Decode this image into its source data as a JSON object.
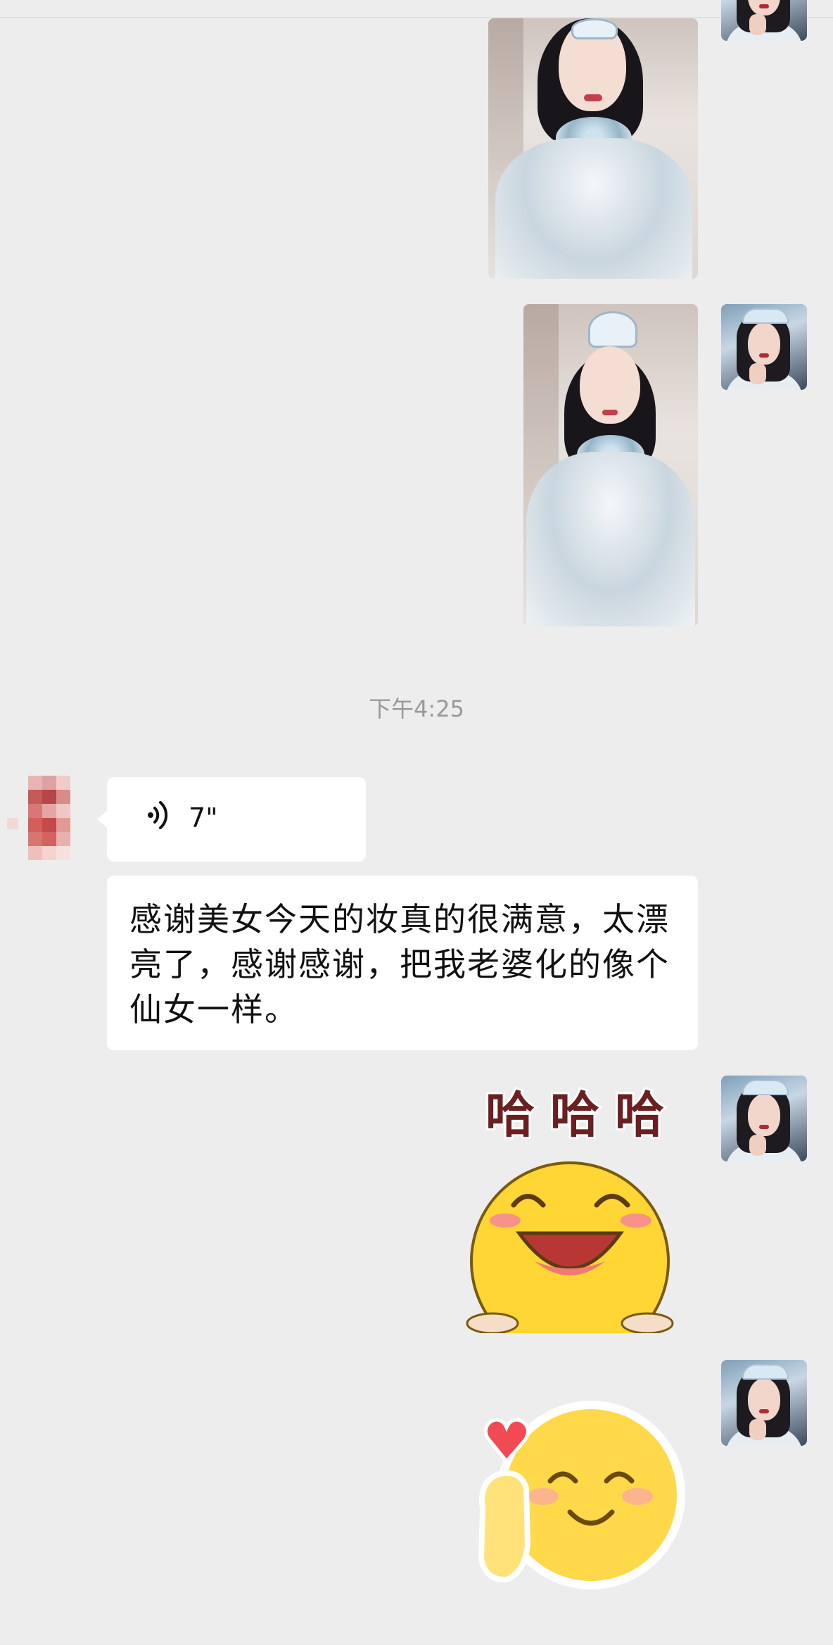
{
  "chat": {
    "time_divider": "下午4:25",
    "voice_message": {
      "duration": "7\""
    },
    "text_message": {
      "text": "感谢美女今天的妆真的很满意，太漂亮了，感谢感谢，把我老婆化的像个仙女一样。"
    },
    "sticker_haha": {
      "text": "哈哈哈"
    }
  },
  "icons": {
    "voice": "voice-wave-icon",
    "heart": "heart-icon"
  },
  "colors": {
    "background": "#ededed",
    "bubble": "#ffffff",
    "timestamp": "#999999",
    "sticker_text": "#6b1f21",
    "emoji_yellow": "#ffd633"
  }
}
